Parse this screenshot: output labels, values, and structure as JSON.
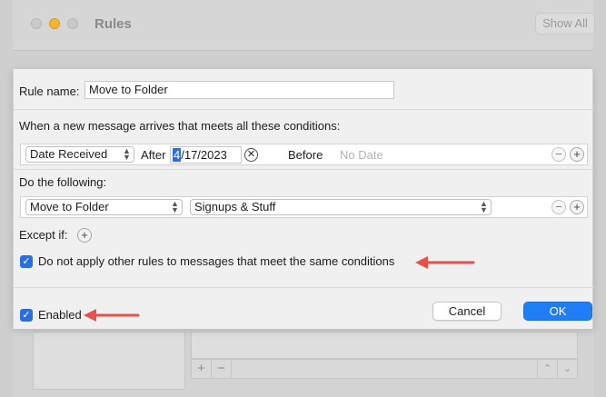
{
  "window": {
    "title": "Rules",
    "show_all_label": "Show All"
  },
  "sheet": {
    "rule_name_label": "Rule name:",
    "rule_name_value": "Move to Folder",
    "conditions_label": "When a new message arrives that meets all these conditions:",
    "condition": {
      "field": "Date Received",
      "after_label": "After",
      "date_selected_part": "4",
      "date_rest": "/17/2023",
      "before_label": "Before",
      "before_placeholder": "No Date"
    },
    "actions_label": "Do the following:",
    "action": {
      "type": "Move to Folder",
      "target": "Signups & Stuff"
    },
    "except_label": "Except if:",
    "no_other_rules_label": "Do not apply other rules to messages that meet the same conditions",
    "enabled_label": "Enabled",
    "cancel_label": "Cancel",
    "ok_label": "OK"
  },
  "glyphs": {
    "check": "✓",
    "plus": "+",
    "minus": "−",
    "clear": "✕",
    "up": "⌃",
    "down": "⌄"
  },
  "colors": {
    "accent": "#1f7ef4",
    "arrow": "#e8504a",
    "traffic_yellow": "#f5b52f"
  }
}
